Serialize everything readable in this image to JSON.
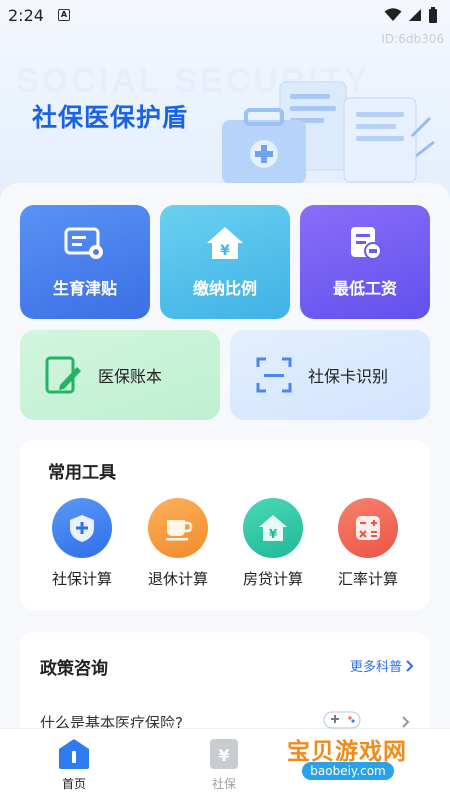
{
  "status_bar": {
    "time": "2:24",
    "notif_glyph": "A"
  },
  "app_id": "ID:6db306",
  "hero": {
    "watermark": "SOCIAL SECURITY",
    "title": "社保医保护盾"
  },
  "grid": [
    {
      "label": "生育津贴",
      "icon": "id-card-gear-icon"
    },
    {
      "label": "缴纳比例",
      "icon": "house-yuan-icon"
    },
    {
      "label": "最低工资",
      "icon": "document-money-icon"
    }
  ],
  "wide_tiles": [
    {
      "label": "医保账本",
      "icon": "edit-document-icon"
    },
    {
      "label": "社保卡识别",
      "icon": "scan-frame-icon"
    }
  ],
  "tools": {
    "title": "常用工具",
    "items": [
      {
        "label": "社保计算",
        "color": "#3d7ef0"
      },
      {
        "label": "退休计算",
        "color": "#f59a3b"
      },
      {
        "label": "房贷计算",
        "color": "#2fc6a6"
      },
      {
        "label": "汇率计算",
        "color": "#f2665a"
      }
    ]
  },
  "policy": {
    "title": "政策咨询",
    "more": "更多科普",
    "first_item": "什么是基本医疗保险?"
  },
  "tabbar": {
    "items": [
      {
        "label": "首页",
        "active": true
      },
      {
        "label": "社保",
        "active": false
      }
    ]
  },
  "watermark_badge": {
    "text": "宝贝游戏网",
    "url": "baobeiy.com"
  },
  "colors": {
    "accent": "#1b63e6",
    "link": "#2f6fe8"
  }
}
